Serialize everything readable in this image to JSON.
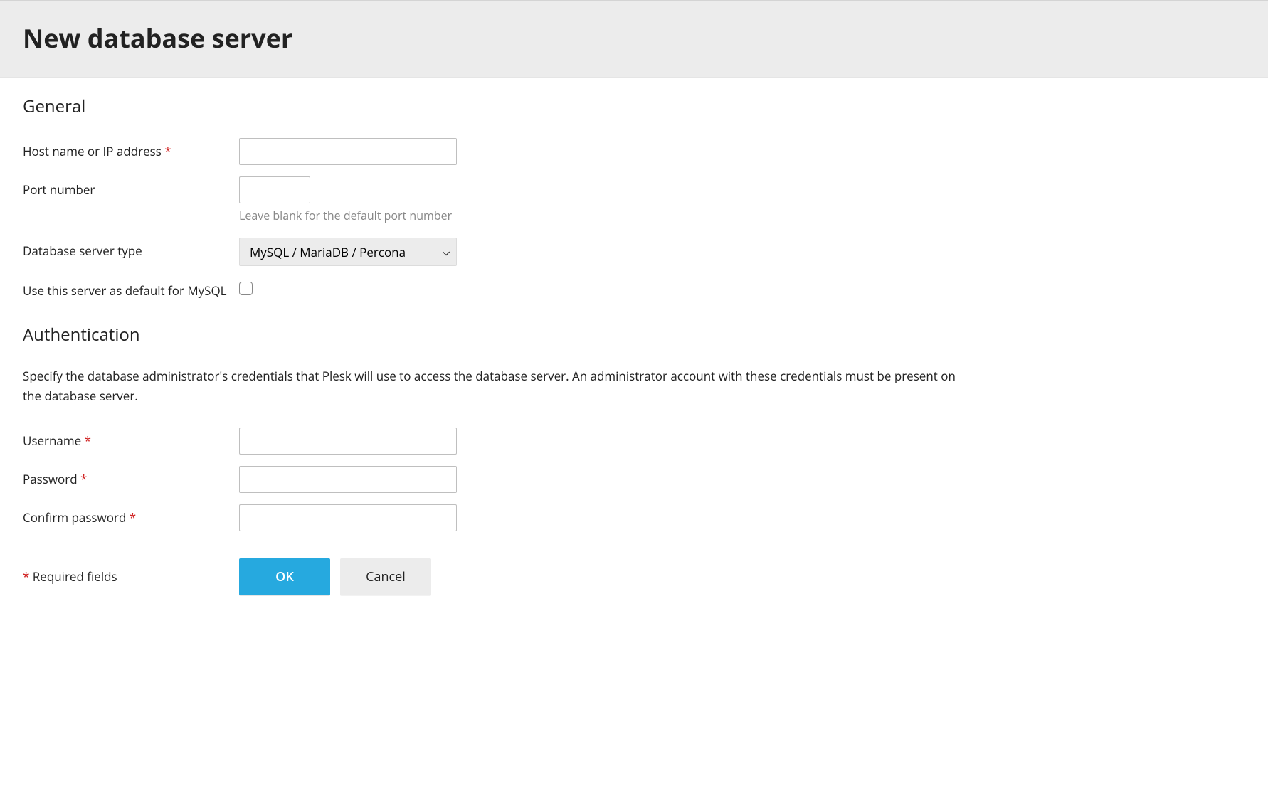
{
  "page": {
    "title": "New database server"
  },
  "sections": {
    "general": {
      "title": "General",
      "fields": {
        "hostname": {
          "label": "Host name or IP address",
          "required": true,
          "value": ""
        },
        "port": {
          "label": "Port number",
          "required": false,
          "value": "",
          "hint": "Leave blank for the default port number"
        },
        "server_type": {
          "label": "Database server type",
          "required": false,
          "selected": "MySQL / MariaDB / Percona"
        },
        "default_mysql": {
          "label": "Use this server as default for MySQL",
          "checked": false
        }
      }
    },
    "auth": {
      "title": "Authentication",
      "description": "Specify the database administrator's credentials that Plesk will use to access the database server. An administrator account with these credentials must be present on the database server.",
      "fields": {
        "username": {
          "label": "Username",
          "required": true,
          "value": ""
        },
        "password": {
          "label": "Password",
          "required": true,
          "value": ""
        },
        "confirm_password": {
          "label": "Confirm password",
          "required": true,
          "value": ""
        }
      }
    }
  },
  "footer": {
    "required_note_prefix": "*",
    "required_note_text": " Required fields",
    "ok_label": "OK",
    "cancel_label": "Cancel"
  }
}
